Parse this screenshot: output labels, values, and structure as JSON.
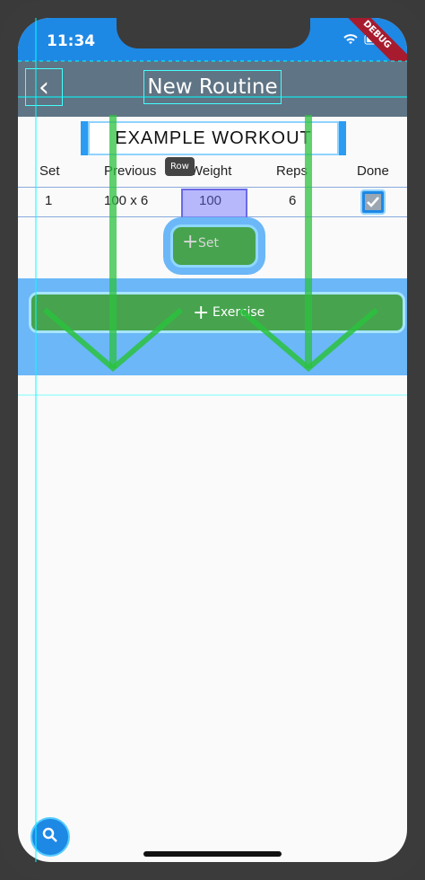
{
  "status": {
    "time": "11:34",
    "debug_label": "DEBUG"
  },
  "appbar": {
    "back_icon": "chevron-left-icon",
    "title": "New Routine"
  },
  "workout": {
    "title": "EXAMPLE WORKOUT"
  },
  "table": {
    "headers": [
      "Set",
      "Previous",
      "Weight",
      "Reps",
      "Done"
    ],
    "rows": [
      {
        "set": "1",
        "previous": "100 x 6",
        "weight": "100",
        "reps": "6",
        "done": true
      }
    ]
  },
  "tooltip": "Row",
  "buttons": {
    "add_set": "Set",
    "add_exercise": "Exercise"
  },
  "fab": {
    "icon": "search-icon"
  },
  "colors": {
    "primary": "#1e88e5",
    "appbar": "#5f7484",
    "button": "#47a34e",
    "overlay": "#6bb7f7",
    "debug": "#a71b2e"
  }
}
